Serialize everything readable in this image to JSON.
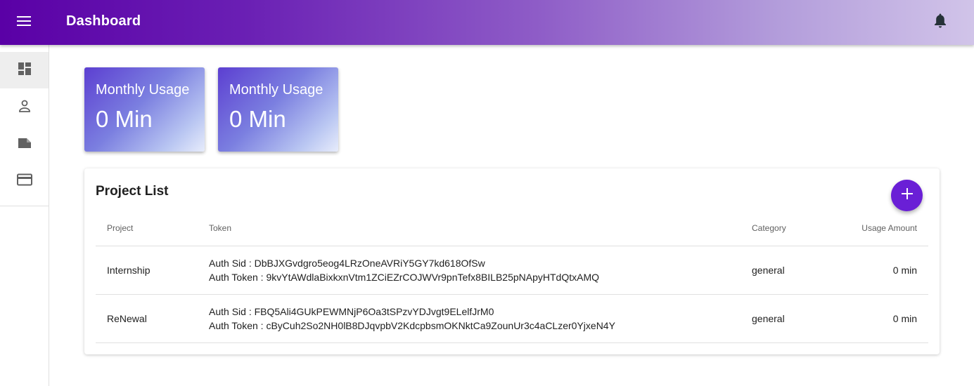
{
  "header": {
    "title": "Dashboard",
    "menu_icon": "menu-icon",
    "bell_icon": "bell-icon"
  },
  "sidebar": {
    "items": [
      {
        "name": "dashboard",
        "icon": "dashboard-icon",
        "active": true
      },
      {
        "name": "account",
        "icon": "person-icon",
        "active": false
      },
      {
        "name": "label",
        "icon": "label-icon",
        "active": false
      },
      {
        "name": "billing",
        "icon": "credit-card-icon",
        "active": false
      }
    ]
  },
  "cards": [
    {
      "title": "Monthly Usage",
      "value": "0 Min"
    },
    {
      "title": "Monthly Usage",
      "value": "0 Min"
    }
  ],
  "project_list": {
    "title": "Project List",
    "add_icon": "plus-icon",
    "columns": [
      "Project",
      "Token",
      "Category",
      "Usage Amount"
    ],
    "rows": [
      {
        "project": "Internship",
        "sid": "Auth Sid : DbBJXGvdgro5eog4LRzOneAVRiY5GY7kd618OfSw",
        "token": "Auth Token : 9kvYtAWdlaBixkxnVtm1ZCiEZrCOJWVr9pnTefx8BILB25pNApyHTdQtxAMQ",
        "category": "general",
        "usage": "0 min"
      },
      {
        "project": "ReNewal",
        "sid": "Auth Sid : FBQ5Ali4GUkPEWMNjP6Oa3tSPzvYDJvgt9ELelfJrM0",
        "token": "Auth Token : cByCuh2So2NH0lB8DJqvpbV2KdcpbsmOKNktCa9ZounUr3c4aCLzer0YjxeN4Y",
        "category": "general",
        "usage": "0 min"
      }
    ]
  },
  "colors": {
    "primary": "#5a00a6",
    "fab": "#6a1fd6",
    "card_start": "#5c3fd1"
  }
}
